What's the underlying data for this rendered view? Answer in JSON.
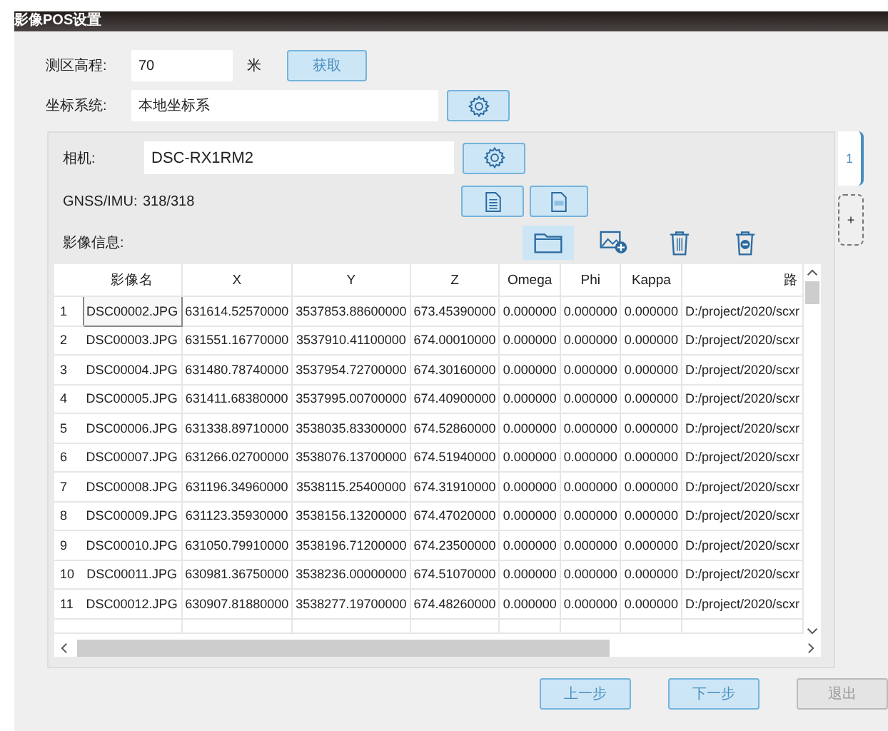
{
  "window": {
    "title": "影像POS设置"
  },
  "survey_elevation": {
    "label": "测区高程:",
    "value": "70",
    "unit": "米",
    "button": "获取"
  },
  "coordinate_system": {
    "label": "坐标系统:",
    "value": "本地坐标系"
  },
  "camera": {
    "label": "相机:",
    "value": "DSC-RX1RM2"
  },
  "gnss_imu": {
    "label": "GNSS/IMU:",
    "value": "318/318"
  },
  "image_info": {
    "label": "影像信息:"
  },
  "image_tools": [
    {
      "kind": "folder",
      "selected": true
    },
    {
      "kind": "add-image",
      "selected": false
    },
    {
      "kind": "delete",
      "selected": false
    },
    {
      "kind": "remove",
      "selected": false
    }
  ],
  "table": {
    "columns": [
      "影像名",
      "X",
      "Y",
      "Z",
      "Omega",
      "Phi",
      "Kappa",
      "路"
    ],
    "rows": [
      {
        "index": "1",
        "selected": true,
        "cells": [
          "DSC00002.JPG",
          "631614.52570000",
          "3537853.88600000",
          "673.45390000",
          "0.000000",
          "0.000000",
          "0.000000",
          "D:/project/2020/scxr"
        ]
      },
      {
        "index": "2",
        "selected": false,
        "cells": [
          "DSC00003.JPG",
          "631551.16770000",
          "3537910.41100000",
          "674.00010000",
          "0.000000",
          "0.000000",
          "0.000000",
          "D:/project/2020/scxr"
        ]
      },
      {
        "index": "3",
        "selected": false,
        "cells": [
          "DSC00004.JPG",
          "631480.78740000",
          "3537954.72700000",
          "674.30160000",
          "0.000000",
          "0.000000",
          "0.000000",
          "D:/project/2020/scxr"
        ]
      },
      {
        "index": "4",
        "selected": false,
        "cells": [
          "DSC00005.JPG",
          "631411.68380000",
          "3537995.00700000",
          "674.40900000",
          "0.000000",
          "0.000000",
          "0.000000",
          "D:/project/2020/scxr"
        ]
      },
      {
        "index": "5",
        "selected": false,
        "cells": [
          "DSC00006.JPG",
          "631338.89710000",
          "3538035.83300000",
          "674.52860000",
          "0.000000",
          "0.000000",
          "0.000000",
          "D:/project/2020/scxr"
        ]
      },
      {
        "index": "6",
        "selected": false,
        "cells": [
          "DSC00007.JPG",
          "631266.02700000",
          "3538076.13700000",
          "674.51940000",
          "0.000000",
          "0.000000",
          "0.000000",
          "D:/project/2020/scxr"
        ]
      },
      {
        "index": "7",
        "selected": false,
        "cells": [
          "DSC00008.JPG",
          "631196.34960000",
          "3538115.25400000",
          "674.31910000",
          "0.000000",
          "0.000000",
          "0.000000",
          "D:/project/2020/scxr"
        ]
      },
      {
        "index": "8",
        "selected": false,
        "cells": [
          "DSC00009.JPG",
          "631123.35930000",
          "3538156.13200000",
          "674.47020000",
          "0.000000",
          "0.000000",
          "0.000000",
          "D:/project/2020/scxr"
        ]
      },
      {
        "index": "9",
        "selected": false,
        "cells": [
          "DSC00010.JPG",
          "631050.79910000",
          "3538196.71200000",
          "674.23500000",
          "0.000000",
          "0.000000",
          "0.000000",
          "D:/project/2020/scxr"
        ]
      },
      {
        "index": "10",
        "selected": false,
        "cells": [
          "DSC00011.JPG",
          "630981.36750000",
          "3538236.00000000",
          "674.51070000",
          "0.000000",
          "0.000000",
          "0.000000",
          "D:/project/2020/scxr"
        ]
      },
      {
        "index": "11",
        "selected": false,
        "cells": [
          "DSC00012.JPG",
          "630907.81880000",
          "3538277.19700000",
          "674.48260000",
          "0.000000",
          "0.000000",
          "0.000000",
          "D:/project/2020/scxr"
        ]
      }
    ]
  },
  "side_tabs": [
    {
      "kind": "tab",
      "label": "1",
      "selected": true
    },
    {
      "kind": "add",
      "label": "+",
      "selected": false
    }
  ],
  "buttons": [
    {
      "label": "上一步",
      "disabled": false
    },
    {
      "label": "下一步",
      "disabled": false
    },
    {
      "label": "退出",
      "disabled": true
    }
  ]
}
